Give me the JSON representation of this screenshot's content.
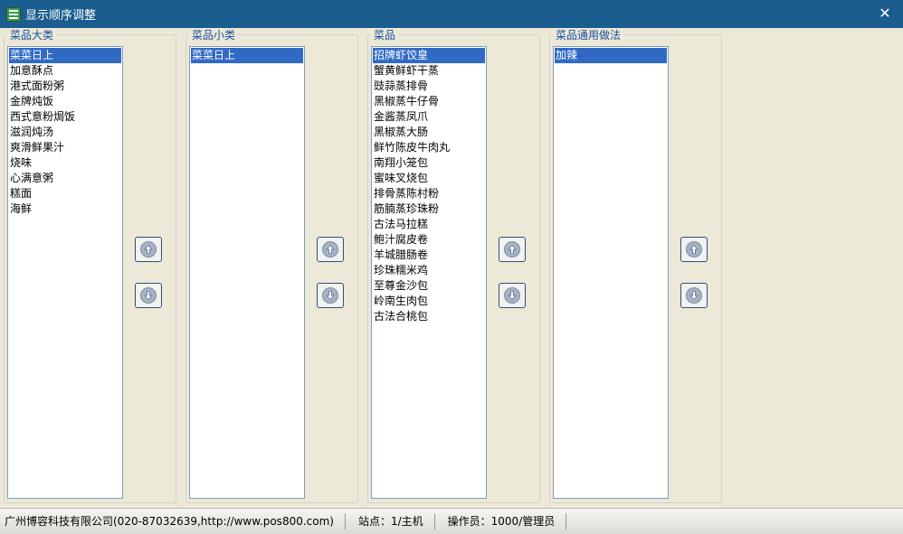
{
  "window": {
    "title": "显示顺序调整",
    "close_glyph": "✕"
  },
  "groups": [
    {
      "label": "菜品大类",
      "items": [
        "菜菜日上",
        "加意酥点",
        "港式面粉粥",
        "金牌炖饭",
        "西式意粉焗饭",
        "滋润炖汤",
        "爽滑鲜果汁",
        "烧味",
        "心满意粥",
        "糕面",
        "海鲜"
      ],
      "selected_index": 0
    },
    {
      "label": "菜品小类",
      "items": [
        "菜菜日上"
      ],
      "selected_index": 0
    },
    {
      "label": "菜品",
      "items": [
        "招牌虾饺皇",
        "蟹黄鲜虾干蒸",
        "豉蒜蒸排骨",
        "黑椒蒸牛仔骨",
        "金酱蒸凤爪",
        "黑椒蒸大肠",
        "鲜竹陈皮牛肉丸",
        "南翔小笼包",
        "蜜味叉烧包",
        "排骨蒸陈村粉",
        "筋腩蒸珍珠粉",
        "古法马拉糕",
        "鲍汁腐皮卷",
        "羊城腊肠卷",
        "珍珠糯米鸡",
        "至尊金沙包",
        "岭南生肉包",
        "古法合桃包"
      ],
      "selected_index": 0
    },
    {
      "label": "菜品通用做法",
      "items": [
        "加辣"
      ],
      "selected_index": 0
    }
  ],
  "buttons": {
    "move_up_icon": "arrow-up-icon",
    "move_down_icon": "arrow-down-icon"
  },
  "statusbar": {
    "company": "广州博容科技有限公司(020-87032639,http://www.pos800.com)",
    "station": "站点：1/主机",
    "operator": "操作员：1000/管理员"
  },
  "colors": {
    "titlebar": "#1B5D8E",
    "selection": "#316AC5",
    "group_label": "#1A4FA0",
    "background": "#ECE9D8"
  }
}
